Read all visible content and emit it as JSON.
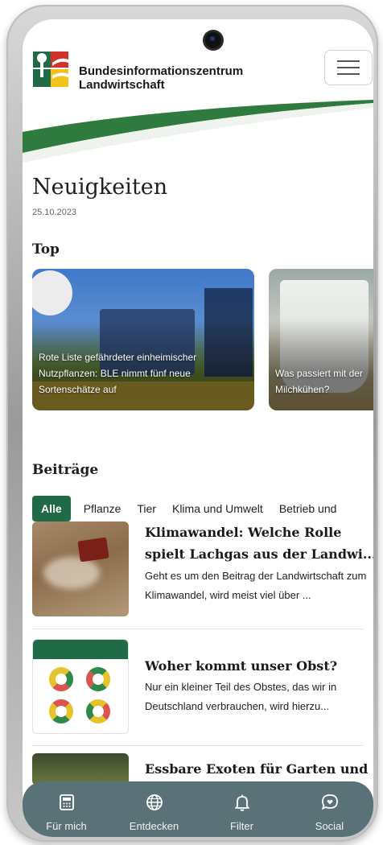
{
  "header": {
    "brand_line1": "Bundesinformationszentrum",
    "brand_line2": "Landwirtschaft",
    "menu_icon": "hamburger-menu-icon"
  },
  "page": {
    "title": "Neuigkeiten",
    "date": "25.10.2023"
  },
  "top": {
    "heading": "Top",
    "cards": [
      {
        "caption": "Rote Liste gefährdeter einheimischer Nutzpflanzen: BLE nimmt fünf neue Sortenschätze auf"
      },
      {
        "caption": "Was passiert mit der Milchkühen?"
      }
    ]
  },
  "posts": {
    "heading": "Beiträge",
    "tabs": [
      "Alle",
      "Pflanze",
      "Tier",
      "Klima und Umwelt",
      "Betrieb und"
    ],
    "articles": [
      {
        "title": "Klimawandel: Welche Rolle spielt Lachgas aus der Landwi...",
        "text": "Geht es um den Beitrag der Landwirtschaft zum Klimawandel, wird meist viel über ..."
      },
      {
        "title": "Woher kommt unser Obst?",
        "text": "Nur ein kleiner Teil des Obstes, das wir in Deutschland verbrauchen, wird hierzu..."
      },
      {
        "title": "Essbare Exoten für Garten und",
        "text": ""
      }
    ]
  },
  "bottom_nav": [
    {
      "label": "Für mich",
      "icon": "calculator-icon"
    },
    {
      "label": "Entdecken",
      "icon": "globe-icon"
    },
    {
      "label": "Filter",
      "icon": "bell-icon"
    },
    {
      "label": "Social",
      "icon": "chat-heart-icon"
    }
  ],
  "colors": {
    "brand_green": "#1f6b47",
    "nav_background": "#5a7178",
    "logo_red": "#d3322a",
    "logo_yellow": "#f2c21b"
  }
}
